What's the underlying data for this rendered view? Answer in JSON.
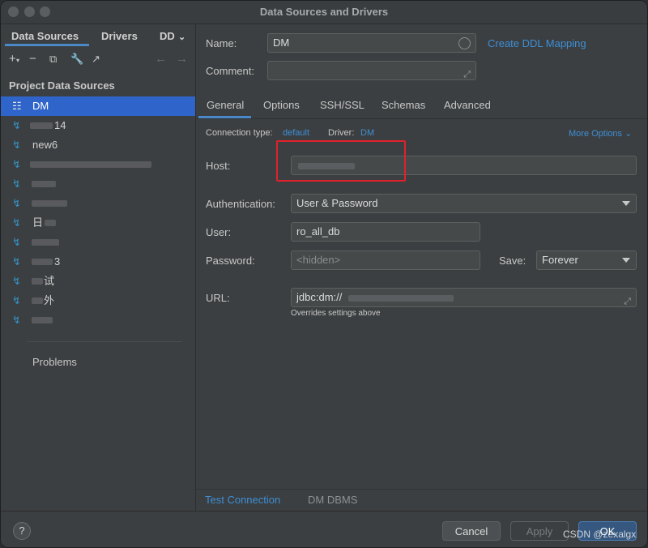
{
  "window": {
    "title": "Data Sources and Drivers"
  },
  "sidebar": {
    "tabs": [
      {
        "label": "Data Sources",
        "active": true
      },
      {
        "label": "Drivers",
        "active": false
      },
      {
        "label": "DD",
        "active": false
      }
    ],
    "section_title": "Project Data Sources",
    "items": [
      {
        "label": "DM",
        "selected": true
      },
      {
        "label": "14",
        "selected": false
      },
      {
        "label": "new6",
        "selected": false
      },
      {
        "label": "",
        "selected": false
      },
      {
        "label": "",
        "selected": false
      },
      {
        "label": "",
        "selected": false
      },
      {
        "label": "日",
        "selected": false
      },
      {
        "label": "",
        "selected": false
      },
      {
        "label": "3",
        "selected": false
      },
      {
        "label": "试",
        "selected": false
      },
      {
        "label": "外",
        "selected": false
      },
      {
        "label": "",
        "selected": false
      }
    ],
    "problems_label": "Problems"
  },
  "main": {
    "name_label": "Name:",
    "name_value": "DM",
    "create_ddl_link": "Create DDL Mapping",
    "comment_label": "Comment:",
    "comment_value": "",
    "tabs": [
      "General",
      "Options",
      "SSH/SSL",
      "Schemas",
      "Advanced"
    ],
    "active_tab": "General",
    "connection_type_label": "Connection type:",
    "connection_type_value": "default",
    "driver_label": "Driver:",
    "driver_value": "DM",
    "more_options": "More Options",
    "host_label": "Host:",
    "auth_label": "Authentication:",
    "auth_value": "User & Password",
    "user_label": "User:",
    "user_value": "ro_all_db",
    "password_label": "Password:",
    "password_placeholder": "<hidden>",
    "save_label": "Save:",
    "save_value": "Forever",
    "url_label": "URL:",
    "url_value": "jdbc:dm://",
    "url_note": "Overrides settings above",
    "test_connection": "Test Connection",
    "dm_dbms": "DM DBMS"
  },
  "footer": {
    "help": "?",
    "cancel": "Cancel",
    "apply": "Apply",
    "ok": "OK",
    "watermark": "CSDN @zexalgx"
  },
  "colors": {
    "accent": "#3d8fd6",
    "selection": "#2f65ca",
    "highlight_box": "#e0212b"
  }
}
